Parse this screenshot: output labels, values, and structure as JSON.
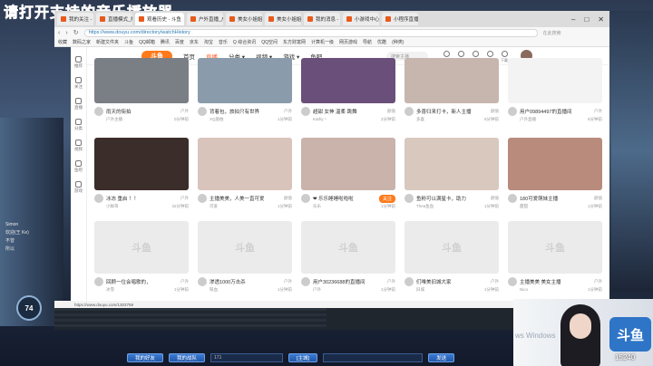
{
  "overlay": {
    "title": "请打开支持的音乐播放器",
    "hud_number": "74"
  },
  "browser": {
    "tabs": [
      {
        "label": "我的关注 - 斗鱼"
      },
      {
        "label": "直播模式_播放中"
      },
      {
        "label": "观看历史 - 斗鱼",
        "active": true
      },
      {
        "label": "户外直播_户外..."
      },
      {
        "label": "美女小姐姐们 直播"
      },
      {
        "label": "美女小姐姐们 直播"
      },
      {
        "label": "我的消息 - 个人中心"
      },
      {
        "label": "小游戏中心 - 斗鱼"
      },
      {
        "label": "小程序直播间"
      }
    ],
    "url": "https://www.douyu.com/directory/watchHistory",
    "search_placeholder": "在此搜索",
    "bookmarks": [
      "收藏",
      "数码之家",
      "新建文件夹",
      "斗鱼",
      "QQ邮箱",
      "腾讯",
      "百度",
      "京东",
      "淘宝",
      "音乐",
      "Q 综合资讯",
      "QQ空间",
      "东方财富网",
      "计算机一级",
      "网页游戏",
      "导航",
      "优酷",
      "(种类)"
    ]
  },
  "site": {
    "logo": "斗鱼",
    "nav": [
      {
        "label": "首页"
      },
      {
        "label": "直播",
        "active": true
      },
      {
        "label": "分类 ▾"
      },
      {
        "label": "视频 ▾"
      },
      {
        "label": "游戏 ▾"
      },
      {
        "label": "鱼吧"
      }
    ],
    "search_placeholder": "搜索主播",
    "top_icons": [
      "历史",
      "关注",
      "消息",
      "任务",
      "下载"
    ],
    "sidebar": [
      "推荐",
      "关注",
      "直播",
      "分类",
      "视频",
      "鱼吧",
      "游戏"
    ]
  },
  "cards": [
    {
      "title": "雨天的街拍",
      "cat": "户外",
      "user": "户外主播",
      "views": "0分钟前",
      "color": "#7a7f86"
    },
    {
      "title": "背着包，旅拍只有世界",
      "cat": "户外",
      "user": "XQ旅拍",
      "views": "1分钟前",
      "color": "#8a9bab"
    },
    {
      "title": "超甜 女神 温柔 跳舞",
      "cat": "颜值",
      "user": "Kathy丶",
      "views": "2分钟前",
      "color": "#6a4f7a"
    },
    {
      "title": "多喜归来打卡，新人主播",
      "cat": "颜值",
      "user": "多喜",
      "views": "5分钟前",
      "color": "#c7b6ad"
    },
    {
      "title": "用户09894497的直播间",
      "cat": "户外",
      "user": "户外直播",
      "views": "5分钟前",
      "color": "#f3f3f3"
    },
    {
      "title": "冰冻 重启 ！！",
      "cat": "户外",
      "user": "小鲜哥",
      "views": "32分钟前",
      "color": "#3b2d2a"
    },
    {
      "title": "主播美美，人美一直可爱",
      "cat": "颜值",
      "user": "可爱",
      "views": "1分钟前",
      "color": "#d9c4bc"
    },
    {
      "title": "❤ 乐乐睡睡啦啦啦",
      "cat": "颜值",
      "user": "乐乐",
      "views": "1分钟前",
      "color": "#c9b3aa",
      "follow": "关注"
    },
    {
      "title": "鱼粉可以满星卡，助力",
      "cat": "颜值",
      "user": "Thea鱼鱼",
      "views": "1分钟前",
      "color": "#d8c8bd"
    },
    {
      "title": "180可爱萌妹主播",
      "cat": "颜值",
      "user": "甜甜",
      "views": "1分钟前",
      "color": "#b98b7c"
    },
    {
      "title": "回顾一位会唱歌的，",
      "cat": "户外",
      "user": "冰雪",
      "views": "1分钟前",
      "placeholder": true
    },
    {
      "title": "渗透1000万击杀",
      "cat": "户外",
      "user": "铁血",
      "views": "1分钟前",
      "placeholder": true
    },
    {
      "title": "用户30236688的直播间",
      "cat": "户外",
      "user": "户外",
      "views": "1分钟前",
      "placeholder": true
    },
    {
      "title": "们唯美旧城大家",
      "cat": "户外",
      "user": "旧城",
      "views": "1分钟前",
      "placeholder": true
    },
    {
      "title": "主播美美 美女主播",
      "cat": "户外",
      "user": "Nico",
      "views": "1分钟前",
      "placeholder": true
    }
  ],
  "placeholder_text": "斗鱼",
  "status_url": "https://www.douyu.com/1303759",
  "bottom": {
    "friends": "我的好友",
    "teams": "我的战队",
    "channel": "[主城]",
    "count": "171",
    "send": "发送"
  },
  "webcam": {
    "logo": "斗鱼",
    "number": "15240",
    "text": "ws Windows"
  },
  "left_lines": [
    "Simon",
    "欢迎(王 Ke)",
    "不曾",
    "所以"
  ]
}
